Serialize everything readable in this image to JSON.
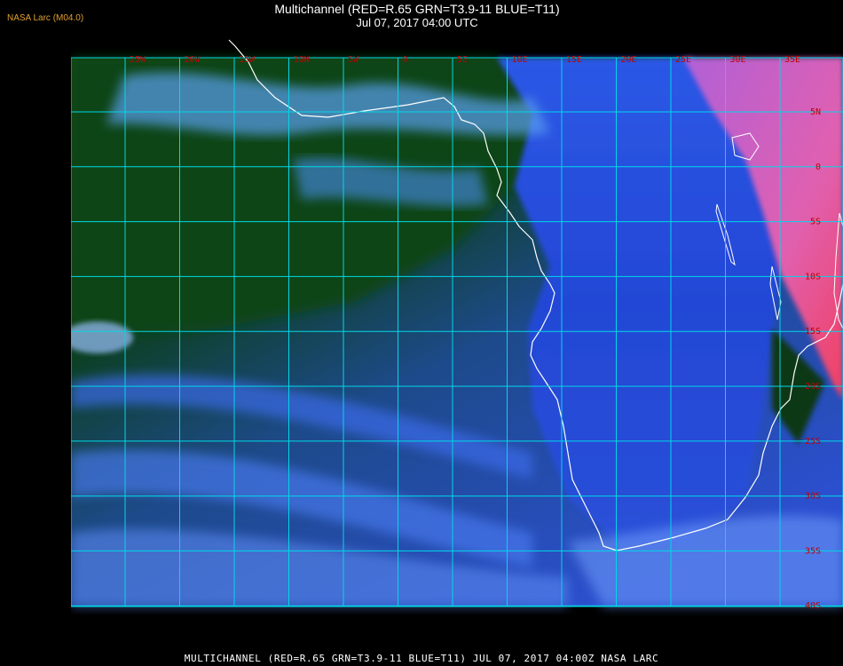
{
  "header": {
    "corner_label": "NASA Larc (M04.0)",
    "title": "Multichannel (RED=R.65 GRN=T3.9-11 BLUE=T11)",
    "subtitle": "Jul 07, 2017 04:00 UTC"
  },
  "footer": {
    "caption": "MULTICHANNEL (RED=R.65 GRN=T3.9-11 BLUE=T11) JUL 07, 2017 04:00Z   NASA LARC"
  },
  "map": {
    "longitude_labels": [
      "25W",
      "20W",
      "15W",
      "10W",
      "5W",
      "0",
      "5E",
      "10E",
      "15E",
      "20E",
      "25E",
      "30E",
      "35E"
    ],
    "latitude_labels": [
      "5N",
      "0",
      "5S",
      "10S",
      "15S",
      "20S",
      "25S",
      "30S",
      "35S",
      "40S"
    ],
    "colors": {
      "grid": "#00d8e8",
      "coastline": "#ffffff",
      "grid_label": "#c00000",
      "ocean_green": "#0a3d12",
      "ocean_blue": "#2a55d8",
      "land_pink": "#d860b8"
    }
  }
}
